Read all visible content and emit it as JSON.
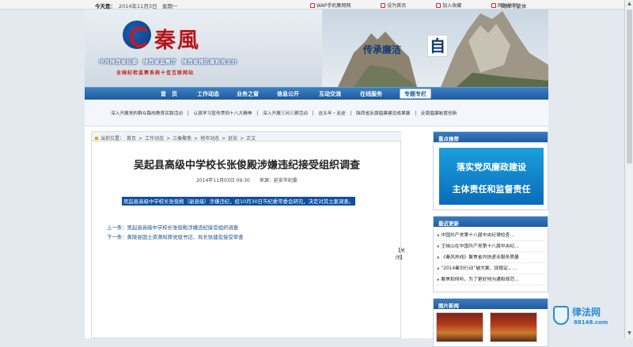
{
  "topbar": {
    "date_label": "今天是：",
    "date_value": "2014年11月3日　星期一",
    "links": [
      "WAP手机集网网",
      "设为首页",
      "加入收藏",
      "网站地图"
    ],
    "lang_simplified": "简体",
    "lang_sep": "|",
    "lang_traditional": "繁体"
  },
  "banner": {
    "brand": "秦風",
    "subtitle": "中共陕西省纪委　陕西省监察厅　陕西省预防腐败局主办",
    "subtitle2": "全国纪检监察系统十佳互联网站",
    "slogan": "传承廉洁",
    "slogan_char": "自"
  },
  "nav": {
    "items": [
      "首　页",
      "工作动态",
      "业务之窗",
      "信息公开",
      "互动交流",
      "在线服务",
      "专题专栏"
    ]
  },
  "notices": [
    "深入开展党的群众路线教育实践活动",
    "|",
    "认真学习宣传贯彻十八大精神",
    "|",
    "深入开展三问三察活动",
    "|",
    "这五年・足迹",
    "|",
    "陕西省反腐倡廉建设成果展",
    "|",
    "反腐倡廉制度创新"
  ],
  "breadcrumb": {
    "label": "当前位置：",
    "items": [
      "首页",
      ">",
      "工作动态",
      ">",
      "三秦聚焦",
      ">",
      "地市动态",
      ">",
      "延安",
      ">",
      "正文"
    ]
  },
  "article": {
    "title": "吴起县高级中学校长张俊殿涉嫌违纪接受组织调查",
    "date": "2014年11月03日 09:30",
    "source": "来源：延安市纪委",
    "body": "吴起县高级中学校长张俊殿（副县级）涉嫌违纪，经10月30日市纪委常委会研究，决定对其立案调查。",
    "prev": "上一条：吴起县高级中学校长张俊殿涉嫌违纪接受组织调查",
    "next": "下一条：黄陵县国土资源局原党组书记、局长张建宏接受审查",
    "close": "【关闭】"
  },
  "sidebar": {
    "featured_header": "重点推荐",
    "ad_line1": "落实党风廉政建设",
    "ad_line2": "主体责任和监督责任",
    "recent_header": "最近更新",
    "recent": [
      "中国共产党第十八届中央纪律检查…",
      "王岐山在中国共产党第十八届中央纪…",
      "《秦风热线》聚焦省内快递业服务质量",
      "“2014秦剑行动”破大案、捉稳定，…",
      "聚焦和倾听，为了更好地沟通和规范…"
    ],
    "pics_header": "图片新闻"
  },
  "watermark": {
    "name": "律法网",
    "url": "88148.com"
  },
  "colors": {
    "nav_blue": "#1c5aa0",
    "brand_red": "#b5161a",
    "highlight": "#0e4fa3"
  }
}
